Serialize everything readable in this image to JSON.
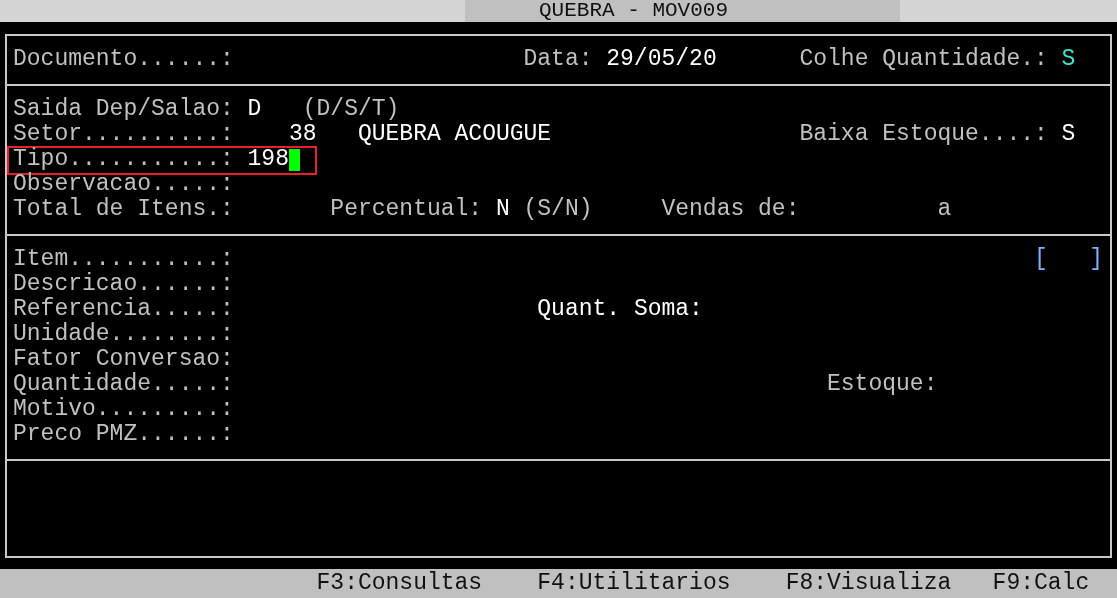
{
  "window": {
    "title": "QUEBRA - MOV009"
  },
  "sections": [
    {
      "rows": [
        {
          "items": [
            {
              "kind": "label",
              "text": "Documento......:"
            },
            {
              "kind": "label",
              "text": "Data:"
            },
            {
              "kind": "value",
              "text": "29/05/20"
            },
            {
              "kind": "label",
              "text": "Colhe Quantidade.:"
            },
            {
              "kind": "accent",
              "text": "S"
            }
          ]
        }
      ]
    },
    {
      "rows": [
        {
          "items": [
            {
              "kind": "label",
              "text": "Saida Dep/Salao:"
            },
            {
              "kind": "value",
              "text": "D"
            },
            {
              "kind": "label",
              "text": "(D/S/T)"
            }
          ]
        },
        {
          "items": [
            {
              "kind": "label",
              "text": "Setor..........:"
            },
            {
              "kind": "value",
              "text": "38"
            },
            {
              "kind": "value",
              "text": "QUEBRA ACOUGUE"
            },
            {
              "kind": "label",
              "text": "Baixa Estoque....:"
            },
            {
              "kind": "value",
              "text": "S"
            }
          ]
        },
        {
          "highlighted": true,
          "items": [
            {
              "kind": "label",
              "text": "Tipo...........:"
            },
            {
              "kind": "value",
              "text": "198",
              "cursor": true
            }
          ]
        },
        {
          "items": [
            {
              "kind": "label",
              "text": "Observacao.....:"
            }
          ]
        },
        {
          "items": [
            {
              "kind": "label",
              "text": "Total de Itens.:"
            },
            {
              "kind": "label",
              "text": "Percentual:"
            },
            {
              "kind": "value",
              "text": "N"
            },
            {
              "kind": "label",
              "text": "(S/N)"
            },
            {
              "kind": "label",
              "text": "Vendas de:"
            },
            {
              "kind": "label",
              "text": "a"
            }
          ]
        }
      ]
    },
    {
      "rows": [
        {
          "items": [
            {
              "kind": "label",
              "text": "Item...........:"
            },
            {
              "kind": "bracket",
              "text": "[   ]"
            }
          ]
        },
        {
          "items": [
            {
              "kind": "label",
              "text": "Descricao......:"
            }
          ]
        },
        {
          "items": [
            {
              "kind": "label",
              "text": "Referencia.....:"
            },
            {
              "kind": "emphasis",
              "text": "Quant. Soma:"
            }
          ]
        },
        {
          "items": [
            {
              "kind": "label",
              "text": "Unidade........:"
            }
          ]
        },
        {
          "items": [
            {
              "kind": "label",
              "text": "Fator Conversao:"
            }
          ]
        },
        {
          "items": [
            {
              "kind": "label",
              "text": "Quantidade.....:"
            },
            {
              "kind": "label",
              "text": "Estoque:"
            }
          ]
        },
        {
          "items": [
            {
              "kind": "label",
              "text": "Motivo.........:"
            }
          ]
        },
        {
          "items": [
            {
              "kind": "label",
              "text": "Preco PMZ......:"
            }
          ]
        }
      ]
    }
  ],
  "function_keys": [
    "F3:Consultas",
    "F4:Utilitarios",
    "F8:Visualiza",
    "F9:Calc"
  ]
}
